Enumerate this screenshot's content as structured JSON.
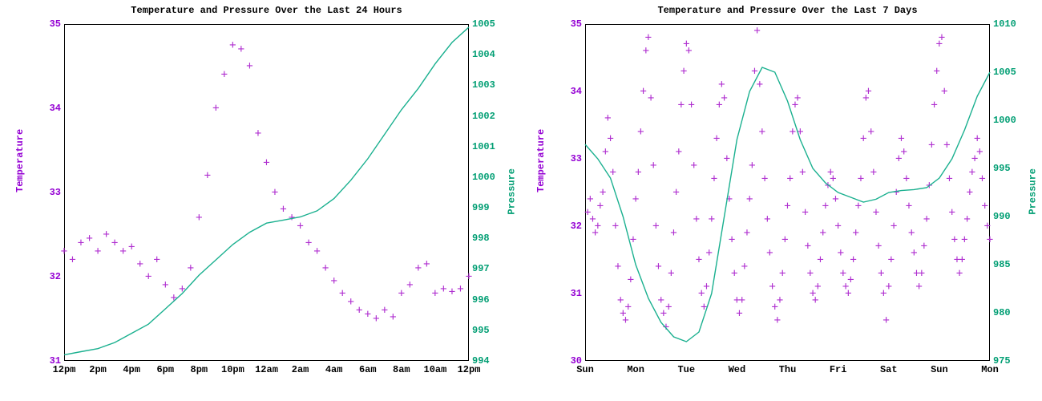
{
  "colors": {
    "temp": "#9400d3",
    "press": "#009e73",
    "line": "#1ab08f",
    "point": "#b030d0"
  },
  "leftTitle": "Temperature and Pressure Over the Last 24 Hours",
  "rightTitle": "Temperature and Pressure Over the Last 7 Days",
  "ylabelTemp": "Temperature",
  "ylabelPress": "Pressure",
  "chart_data": [
    {
      "id": "24h",
      "type": "dual-axis-scatter+line",
      "title": "Temperature and Pressure Over the Last 24 Hours",
      "x_label": "",
      "x_categories": [
        "12pm",
        "2pm",
        "4pm",
        "6pm",
        "8pm",
        "10pm",
        "12am",
        "2am",
        "4am",
        "6am",
        "8am",
        "10am",
        "12pm"
      ],
      "y_left": {
        "label": "Temperature",
        "min": 31,
        "max": 35,
        "ticks": [
          31,
          32,
          33,
          34,
          35
        ]
      },
      "y_right": {
        "label": "Pressure",
        "min": 994,
        "max": 1005,
        "ticks": [
          994,
          995,
          996,
          997,
          998,
          999,
          1000,
          1001,
          1002,
          1003,
          1004,
          1005
        ]
      },
      "series": [
        {
          "name": "Temperature",
          "axis": "left",
          "style": "scatter",
          "marker": "+",
          "x": [
            0,
            0.25,
            0.5,
            0.75,
            1,
            1.25,
            1.5,
            1.75,
            2,
            2.25,
            2.5,
            2.75,
            3,
            3.25,
            3.5,
            3.75,
            4,
            4.25,
            4.5,
            4.75,
            5,
            5.25,
            5.5,
            5.75,
            6,
            6.25,
            6.5,
            6.75,
            7,
            7.25,
            7.5,
            7.75,
            8,
            8.25,
            8.5,
            8.75,
            9,
            9.25,
            9.5,
            9.75,
            10,
            10.25,
            10.5,
            10.75,
            11,
            11.25,
            11.5,
            11.75,
            12
          ],
          "y": [
            32.3,
            32.2,
            32.4,
            32.45,
            32.3,
            32.5,
            32.4,
            32.3,
            32.35,
            32.15,
            32.0,
            32.2,
            31.9,
            31.75,
            31.85,
            32.1,
            32.7,
            33.2,
            34.0,
            34.4,
            34.75,
            34.7,
            34.5,
            33.7,
            33.35,
            33.0,
            32.8,
            32.7,
            32.6,
            32.4,
            32.3,
            32.1,
            31.95,
            31.8,
            31.7,
            31.6,
            31.55,
            31.5,
            31.6,
            31.52,
            31.8,
            31.9,
            32.1,
            32.15,
            31.8,
            31.85,
            31.82,
            31.85,
            32.0
          ]
        },
        {
          "name": "Pressure",
          "axis": "right",
          "style": "line",
          "x": [
            0,
            0.5,
            1,
            1.5,
            2,
            2.5,
            3,
            3.5,
            4,
            4.5,
            5,
            5.5,
            6,
            6.5,
            7,
            7.5,
            8,
            8.5,
            9,
            9.5,
            10,
            10.5,
            11,
            11.5,
            12
          ],
          "y": [
            994.2,
            994.3,
            994.4,
            994.6,
            994.9,
            995.2,
            995.7,
            996.2,
            996.8,
            997.3,
            997.8,
            998.2,
            998.5,
            998.6,
            998.7,
            998.9,
            999.3,
            999.9,
            1000.6,
            1001.4,
            1002.2,
            1002.9,
            1003.7,
            1004.4,
            1004.9
          ]
        }
      ]
    },
    {
      "id": "7d",
      "type": "dual-axis-scatter+line",
      "title": "Temperature and Pressure Over the Last 7 Days",
      "x_label": "",
      "x_categories": [
        "Sun",
        "Mon",
        "Tue",
        "Wed",
        "Thu",
        "Fri",
        "Sat",
        "Sun",
        "Mon"
      ],
      "y_left": {
        "label": "Temperature",
        "min": 30,
        "max": 35,
        "ticks": [
          30,
          31,
          32,
          33,
          34,
          35
        ]
      },
      "y_right": {
        "label": "Pressure",
        "min": 975,
        "max": 1010,
        "ticks": [
          975,
          980,
          985,
          990,
          995,
          1000,
          1005,
          1010
        ]
      },
      "series": [
        {
          "name": "Temperature",
          "axis": "left",
          "style": "scatter",
          "marker": "+",
          "x": [
            0.05,
            0.1,
            0.15,
            0.2,
            0.25,
            0.3,
            0.35,
            0.4,
            0.45,
            0.5,
            0.55,
            0.6,
            0.65,
            0.7,
            0.75,
            0.8,
            0.85,
            0.9,
            0.95,
            1.0,
            1.05,
            1.1,
            1.15,
            1.2,
            1.25,
            1.3,
            1.35,
            1.4,
            1.45,
            1.5,
            1.55,
            1.6,
            1.65,
            1.7,
            1.75,
            1.8,
            1.85,
            1.9,
            1.95,
            2.0,
            2.05,
            2.1,
            2.15,
            2.2,
            2.25,
            2.3,
            2.35,
            2.4,
            2.45,
            2.5,
            2.55,
            2.6,
            2.65,
            2.7,
            2.75,
            2.8,
            2.85,
            2.9,
            2.95,
            3.0,
            3.05,
            3.1,
            3.15,
            3.2,
            3.25,
            3.3,
            3.35,
            3.4,
            3.45,
            3.5,
            3.55,
            3.6,
            3.65,
            3.7,
            3.75,
            3.8,
            3.85,
            3.9,
            3.95,
            4.0,
            4.05,
            4.1,
            4.15,
            4.2,
            4.25,
            4.3,
            4.35,
            4.4,
            4.45,
            4.5,
            4.55,
            4.6,
            4.65,
            4.7,
            4.75,
            4.8,
            4.85,
            4.9,
            4.95,
            5.0,
            5.05,
            5.1,
            5.15,
            5.2,
            5.25,
            5.3,
            5.35,
            5.4,
            5.45,
            5.5,
            5.55,
            5.6,
            5.65,
            5.7,
            5.75,
            5.8,
            5.85,
            5.9,
            5.95,
            6.0,
            6.05,
            6.1,
            6.15,
            6.2,
            6.25,
            6.3,
            6.35,
            6.4,
            6.45,
            6.5,
            6.55,
            6.6,
            6.65,
            6.7,
            6.75,
            6.8,
            6.85,
            6.9,
            6.95,
            7.0,
            7.05,
            7.1,
            7.15,
            7.2,
            7.25,
            7.3,
            7.35,
            7.4,
            7.45,
            7.5,
            7.55,
            7.6,
            7.65,
            7.7,
            7.75,
            7.8,
            7.85,
            7.9,
            7.95,
            8.0
          ],
          "y": [
            32.2,
            32.4,
            32.1,
            31.9,
            32.0,
            32.3,
            32.5,
            33.1,
            33.6,
            33.3,
            32.8,
            32.0,
            31.4,
            30.9,
            30.7,
            30.6,
            30.8,
            31.2,
            31.8,
            32.4,
            32.8,
            33.4,
            34.0,
            34.6,
            34.8,
            33.9,
            32.9,
            32.0,
            31.4,
            30.9,
            30.7,
            30.5,
            30.8,
            31.3,
            31.9,
            32.5,
            33.1,
            33.8,
            34.3,
            34.7,
            34.6,
            33.8,
            32.9,
            32.1,
            31.5,
            31.0,
            30.8,
            31.1,
            31.6,
            32.1,
            32.7,
            33.3,
            33.8,
            34.1,
            33.9,
            33.0,
            32.4,
            31.8,
            31.3,
            30.9,
            30.7,
            30.9,
            31.4,
            31.9,
            32.4,
            32.9,
            34.3,
            34.9,
            34.1,
            33.4,
            32.7,
            32.1,
            31.6,
            31.1,
            30.8,
            30.6,
            30.9,
            31.3,
            31.8,
            32.3,
            32.7,
            33.4,
            33.8,
            33.9,
            33.4,
            32.8,
            32.2,
            31.7,
            31.3,
            31.0,
            30.9,
            31.1,
            31.5,
            31.9,
            32.3,
            32.6,
            32.8,
            32.7,
            32.4,
            32.0,
            31.6,
            31.3,
            31.1,
            31.0,
            31.2,
            31.5,
            31.9,
            32.3,
            32.7,
            33.3,
            33.9,
            34.0,
            33.4,
            32.8,
            32.2,
            31.7,
            31.3,
            31.0,
            30.6,
            31.1,
            31.5,
            32.0,
            32.5,
            33.0,
            33.3,
            33.1,
            32.7,
            32.3,
            31.9,
            31.6,
            31.3,
            31.1,
            31.3,
            31.7,
            32.1,
            32.6,
            33.2,
            33.8,
            34.3,
            34.7,
            34.8,
            34.0,
            33.2,
            32.7,
            32.2,
            31.8,
            31.5,
            31.3,
            31.5,
            31.8,
            32.1,
            32.5,
            32.8,
            33.0,
            33.3,
            33.1,
            32.7,
            32.3,
            32.0,
            31.8
          ]
        },
        {
          "name": "Pressure",
          "axis": "right",
          "style": "line",
          "x": [
            0,
            0.25,
            0.5,
            0.75,
            1.0,
            1.25,
            1.5,
            1.75,
            2.0,
            2.25,
            2.5,
            2.75,
            3.0,
            3.25,
            3.5,
            3.75,
            4.0,
            4.25,
            4.5,
            4.75,
            5.0,
            5.25,
            5.5,
            5.75,
            6.0,
            6.25,
            6.5,
            6.75,
            7.0,
            7.25,
            7.5,
            7.75,
            8.0
          ],
          "y": [
            997.5,
            996.0,
            994.0,
            990.0,
            985.0,
            981.5,
            979.0,
            977.5,
            977.0,
            978.0,
            982.0,
            990.0,
            998.0,
            1003.0,
            1005.5,
            1005.0,
            1002.0,
            998.0,
            995.0,
            993.5,
            992.5,
            992.0,
            991.5,
            991.8,
            992.5,
            992.7,
            992.8,
            993.0,
            994.0,
            996.0,
            999.0,
            1002.5,
            1005.0
          ]
        }
      ]
    }
  ]
}
